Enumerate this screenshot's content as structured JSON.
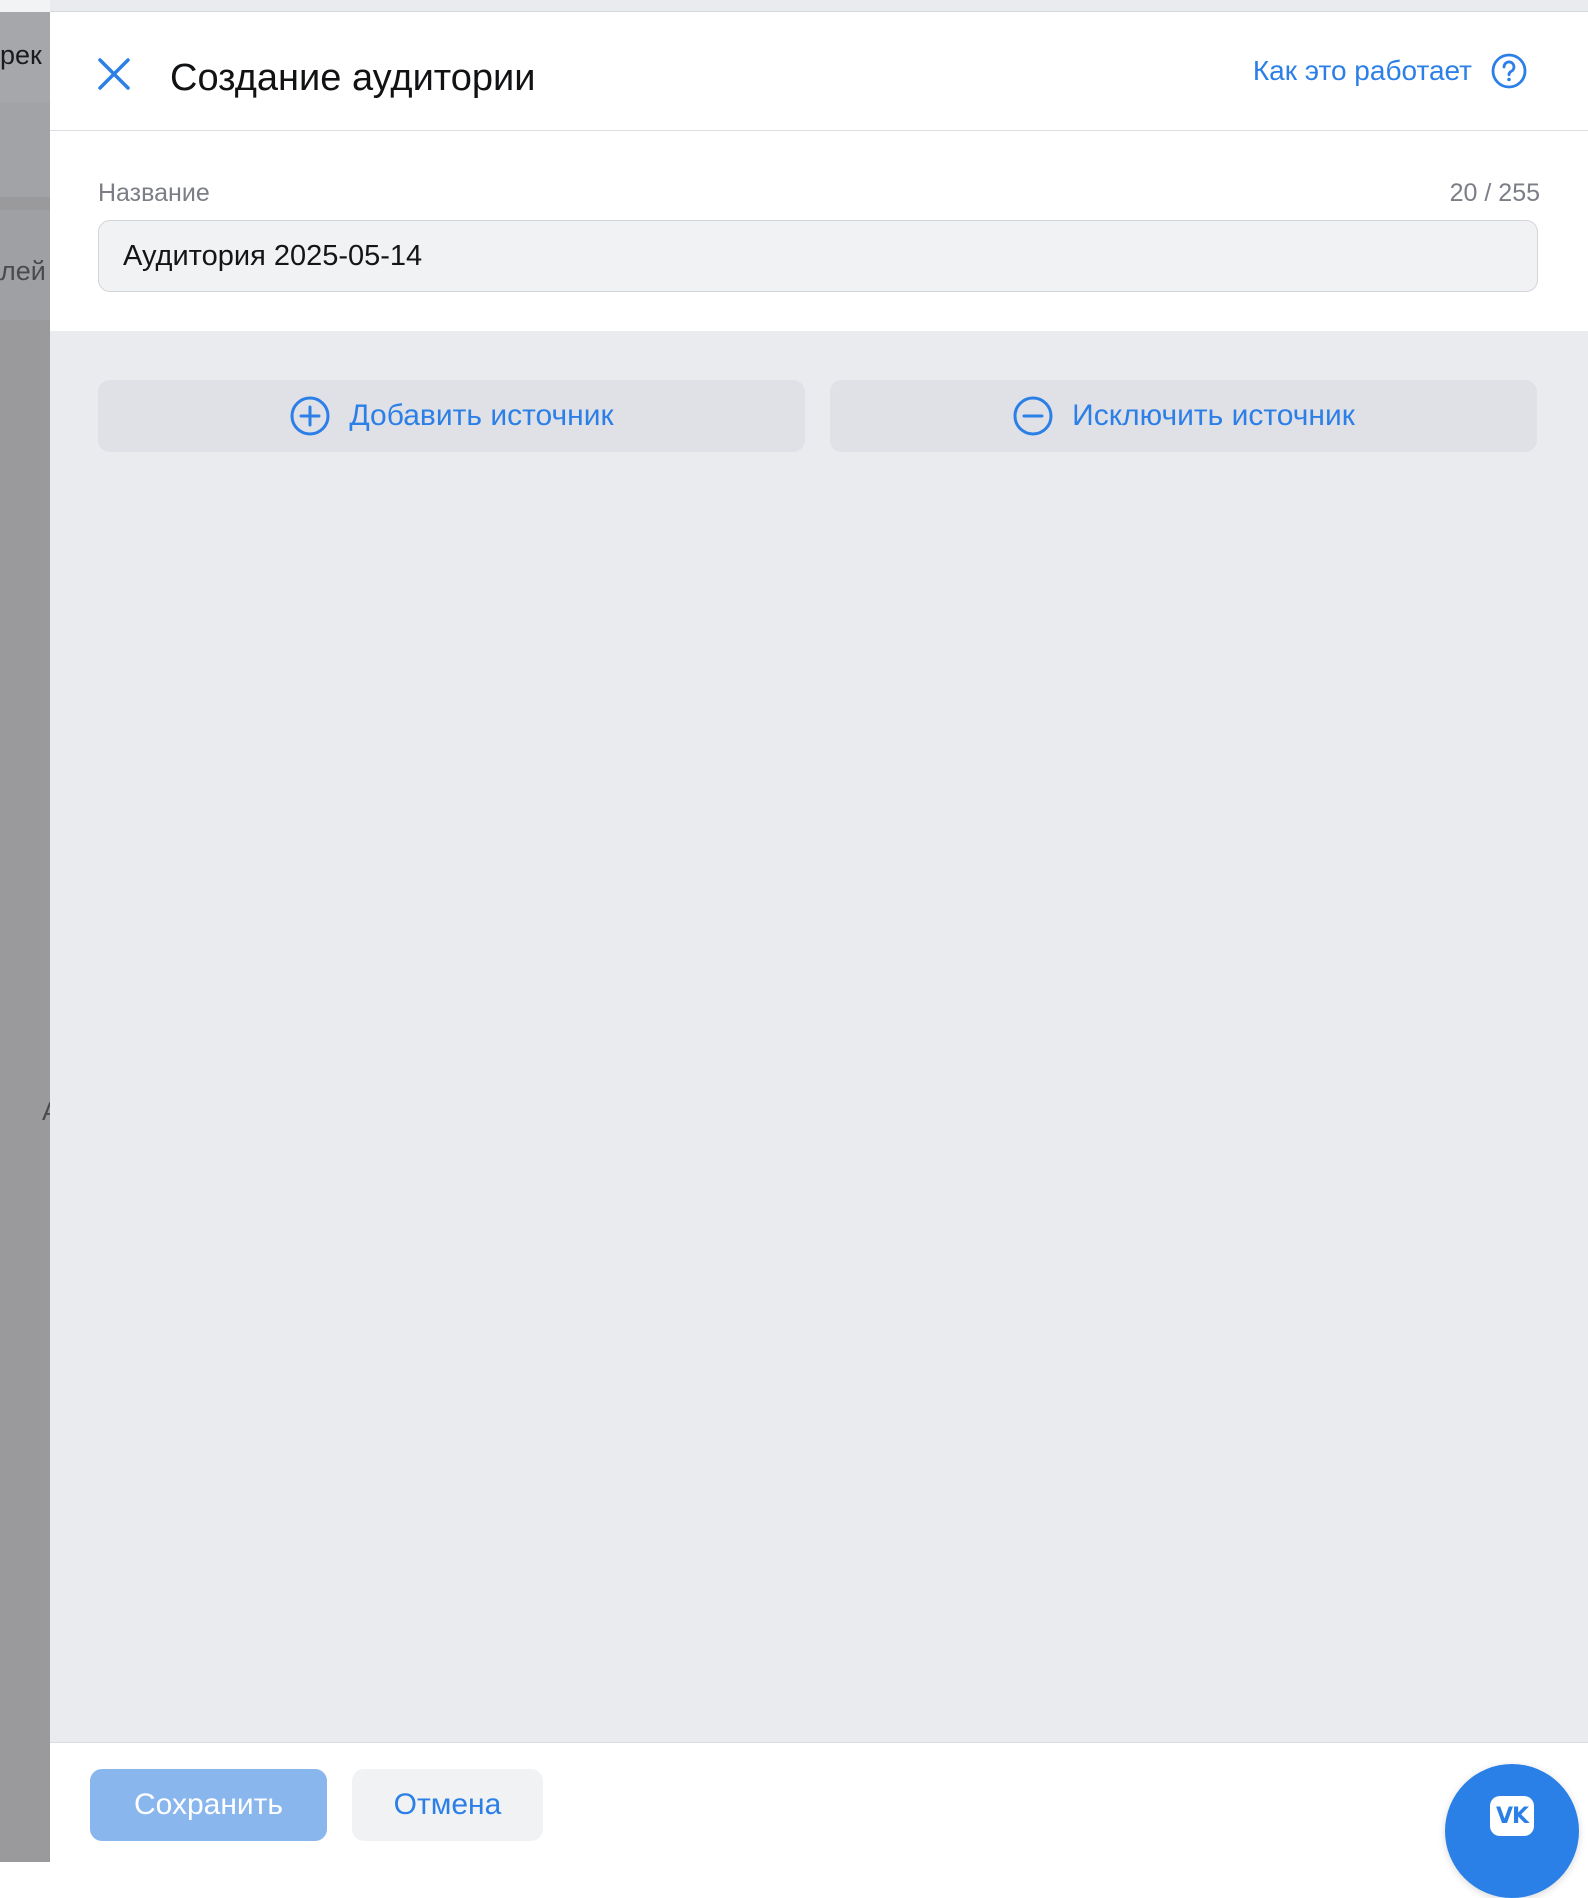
{
  "background": {
    "fragment_1": "рек",
    "fragment_2": "лей",
    "fragment_3": "А"
  },
  "drawer": {
    "title": "Создание аудитории",
    "help_link": "Как это работает",
    "help_icon": "question-circle-icon",
    "close_icon": "close-icon"
  },
  "name_field": {
    "label": "Название",
    "counter": "20 / 255",
    "value": "Аудитория 2025-05-14"
  },
  "sources": {
    "add_label": "Добавить источник",
    "add_icon": "plus-circle-icon",
    "exclude_label": "Исключить источник",
    "exclude_icon": "minus-circle-icon"
  },
  "footer": {
    "save_label": "Сохранить",
    "cancel_label": "Отмена",
    "fab_icon": "vk-logo-icon"
  },
  "colors": {
    "accent": "#2b7fe6",
    "save_button": "#8ab6ee",
    "panel_bg": "#eaebef",
    "source_button_bg": "#dfe1e6"
  }
}
